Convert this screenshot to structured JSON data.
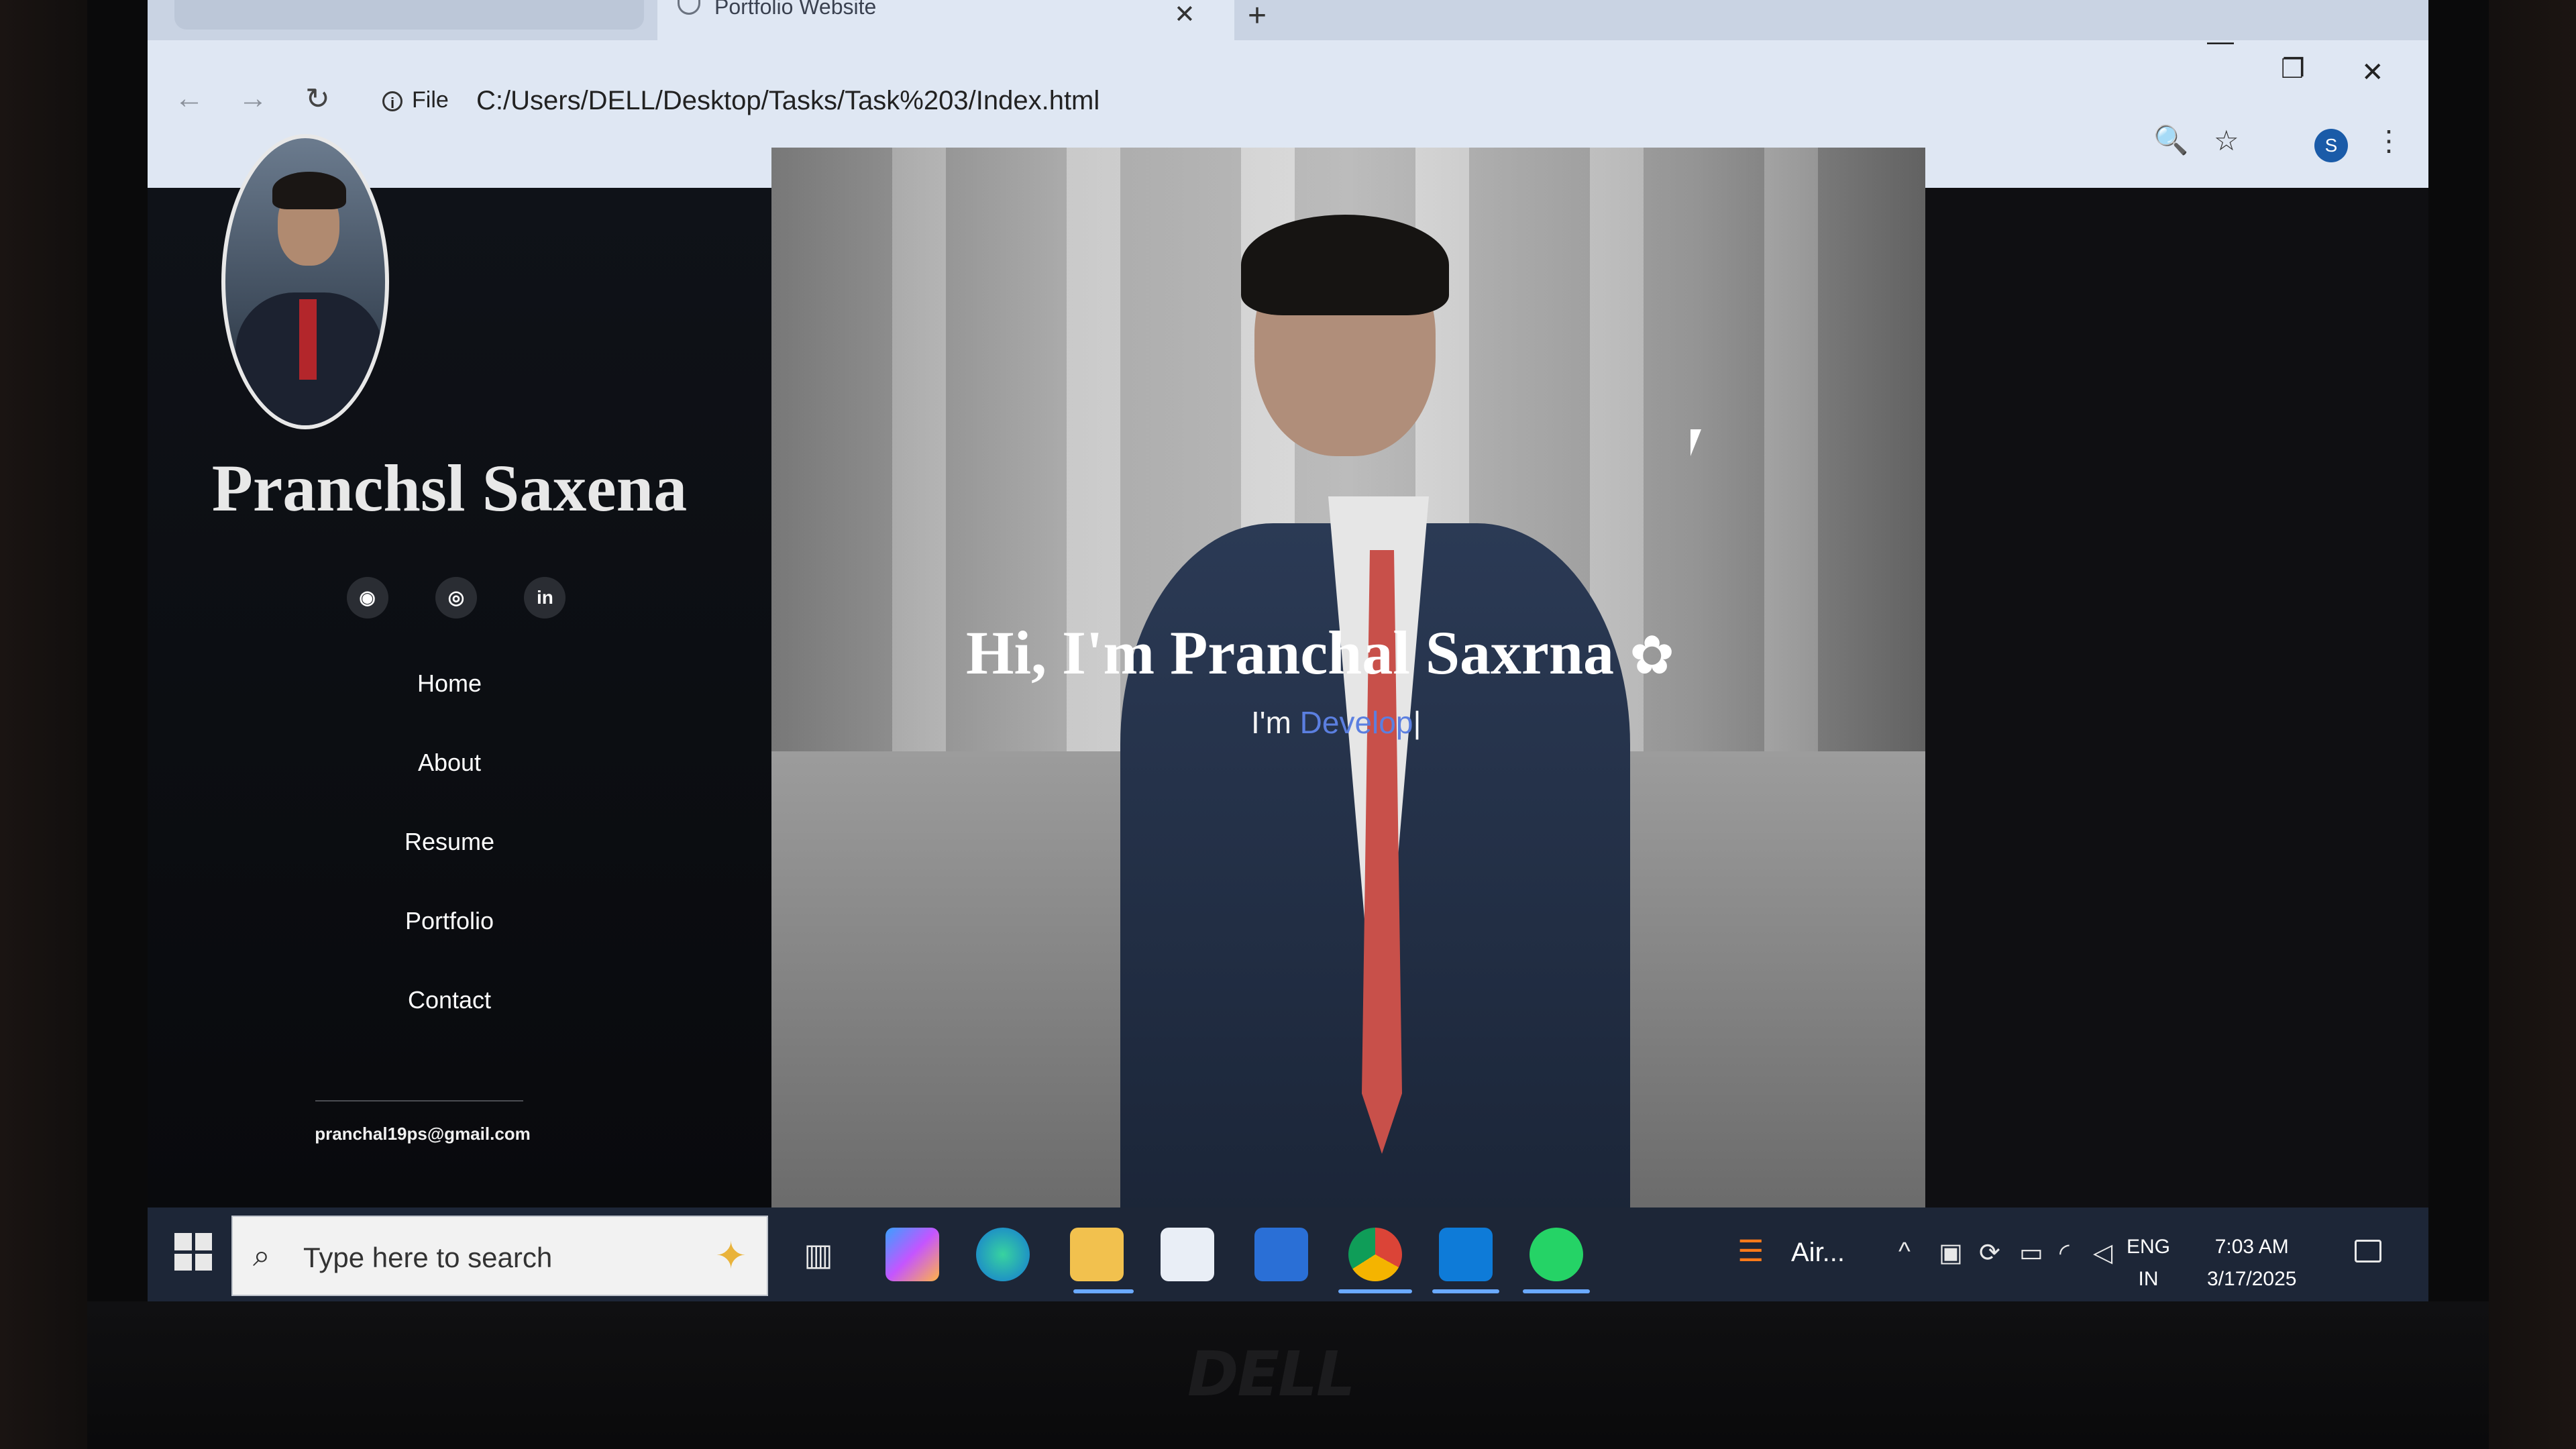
{
  "browser": {
    "active_tab_title": "Portfolio Website",
    "tab_close": "✕",
    "new_tab": "+",
    "back": "←",
    "forward": "→",
    "reload": "↻",
    "site_info_label": "File",
    "url": "C:/Users/DELL/Desktop/Tasks/Task%203/Index.html",
    "zoom_icon": "🔍",
    "bookmark_icon": "☆",
    "profile_initial": "S",
    "menu_icon": "⋮",
    "minimize": "—",
    "restore": "❐",
    "close": "✕"
  },
  "sidebar": {
    "name": "Pranchsl Saxena",
    "socials": [
      {
        "id": "github",
        "glyph": "◉"
      },
      {
        "id": "instagram",
        "glyph": "◎"
      },
      {
        "id": "linkedin",
        "glyph": "in"
      }
    ],
    "menu": [
      "Home",
      "About",
      "Resume",
      "Portfolio",
      "Contact"
    ],
    "email": "pranchal19ps@gmail.com"
  },
  "hero": {
    "title": "Hi, I'm Pranchal Saxrna",
    "title_flower": "✿",
    "sub_prefix": "I'm ",
    "sub_typed": "Develop",
    "caret": "|"
  },
  "taskbar": {
    "search_placeholder": "Type here to search",
    "search_icon": "⌕",
    "spark_icon": "✦",
    "apps": [
      "task-view",
      "copilot",
      "edge",
      "file-explorer",
      "store",
      "outlook",
      "chrome",
      "vscode",
      "whatsapp"
    ],
    "tray_app_label": "Air...",
    "tray_app_icon": "☰",
    "chevron": "^",
    "language": "ENG",
    "region": "IN",
    "time": "7:03 AM",
    "date": "3/17/2025"
  },
  "device": {
    "brand": "DELL"
  },
  "colors": {
    "accent_blue": "#5b7fe0",
    "taskbar": "#1d2637",
    "chrome_toolbar": "#dfe7f3"
  }
}
